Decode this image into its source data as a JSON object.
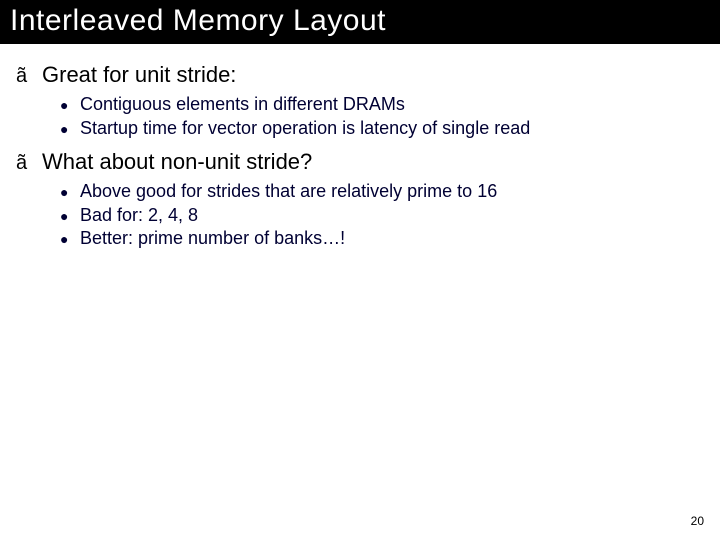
{
  "title": "Interleaved Memory Layout",
  "sections": [
    {
      "marker": "ã",
      "heading": "Great for unit stride:",
      "bullets": [
        "Contiguous elements in different DRAMs",
        "Startup time for vector operation is latency of single read"
      ]
    },
    {
      "marker": "ã",
      "heading": "What about non-unit stride?",
      "bullets": [
        "Above good for strides that are relatively prime to 16",
        "Bad for: 2, 4, 8",
        "Better: prime number of banks…!"
      ]
    }
  ],
  "page_number": "20"
}
